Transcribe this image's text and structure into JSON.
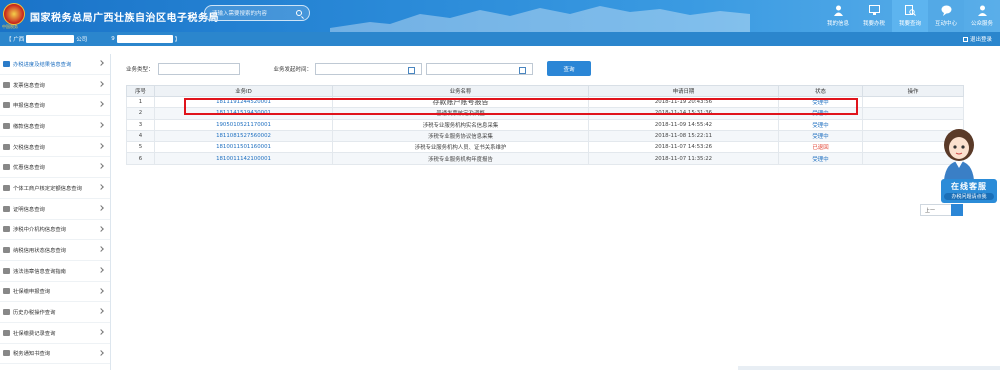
{
  "header": {
    "emblem_text": "中国税务",
    "title": "国家税务总局广西壮族自治区电子税务局",
    "search_placeholder": "请输入需要搜索的内容",
    "nav": [
      {
        "label": "我的信息",
        "icon": "user-icon"
      },
      {
        "label": "我要办税",
        "icon": "monitor-icon"
      },
      {
        "label": "我要查询",
        "icon": "search-doc-icon"
      },
      {
        "label": "互动中心",
        "icon": "chat-icon"
      },
      {
        "label": "公众服务",
        "icon": "person-service-icon"
      }
    ]
  },
  "infobar": {
    "prefix": "【 广西",
    "suffix1": "公司",
    "mid": "9",
    "suffix2": "】",
    "logout_label": "退出登录"
  },
  "sidebar": {
    "items": [
      {
        "label": "办税进度及结果信息查询"
      },
      {
        "label": "发票信息查询"
      },
      {
        "label": "申报信息查询"
      },
      {
        "label": "缴款信息查询"
      },
      {
        "label": "欠税信息查询"
      },
      {
        "label": "优惠信息查询"
      },
      {
        "label": "个体工商户核定定额信息查询"
      },
      {
        "label": "证明信息查询"
      },
      {
        "label": "涉税中介机构信息查询"
      },
      {
        "label": "纳税信用状态信息查询"
      },
      {
        "label": "违法违章信息查询指南"
      },
      {
        "label": "社保缴申报查询"
      },
      {
        "label": "历史办税操作查询"
      },
      {
        "label": "社保缴费记录查询"
      },
      {
        "label": "税务通知书查询"
      }
    ]
  },
  "filter": {
    "type_label": "业务类型：",
    "time_label": "业务发起时间：",
    "query_label": "查询"
  },
  "table": {
    "headers": [
      "序号",
      "业务ID",
      "业务名称",
      "申请日期",
      "状态",
      "操作"
    ],
    "rows": [
      {
        "no": "1",
        "id": "1811191244520001",
        "name": "存款账户账号报告",
        "date": "2018-11-19 20:43:56",
        "status": "受理中"
      },
      {
        "no": "2",
        "id": "1811141519430001",
        "name": "普通发票核定及调整",
        "date": "2018-11-14 15:31:36",
        "status": "受理中"
      },
      {
        "no": "3",
        "id": "1905010521170001",
        "name": "涉税专业服务机构实名信息采集",
        "date": "2018-11-09 14:55:42",
        "status": "受理中"
      },
      {
        "no": "4",
        "id": "1811081527560002",
        "name": "涉税专业服务协议信息采集",
        "date": "2018-11-08 15:22:11",
        "status": "受理中"
      },
      {
        "no": "5",
        "id": "1810011501160001",
        "name": "涉税专业服务机构人员、证书关系维护",
        "date": "2018-11-07 14:53:26",
        "status": "已退回"
      },
      {
        "no": "6",
        "id": "1810011142100001",
        "name": "涉税专业服务机构年度报告",
        "date": "2018-11-07 11:35:22",
        "status": "受理中"
      }
    ]
  },
  "pager": {
    "prev_label": "上一"
  },
  "service": {
    "title": "在线客服",
    "subtitle": "办税问题请点我"
  },
  "colors": {
    "header_blue": "#1a73c8",
    "accent": "#2b86d6",
    "highlight_red": "#e0141c",
    "status_returned": "#e03a2a"
  }
}
